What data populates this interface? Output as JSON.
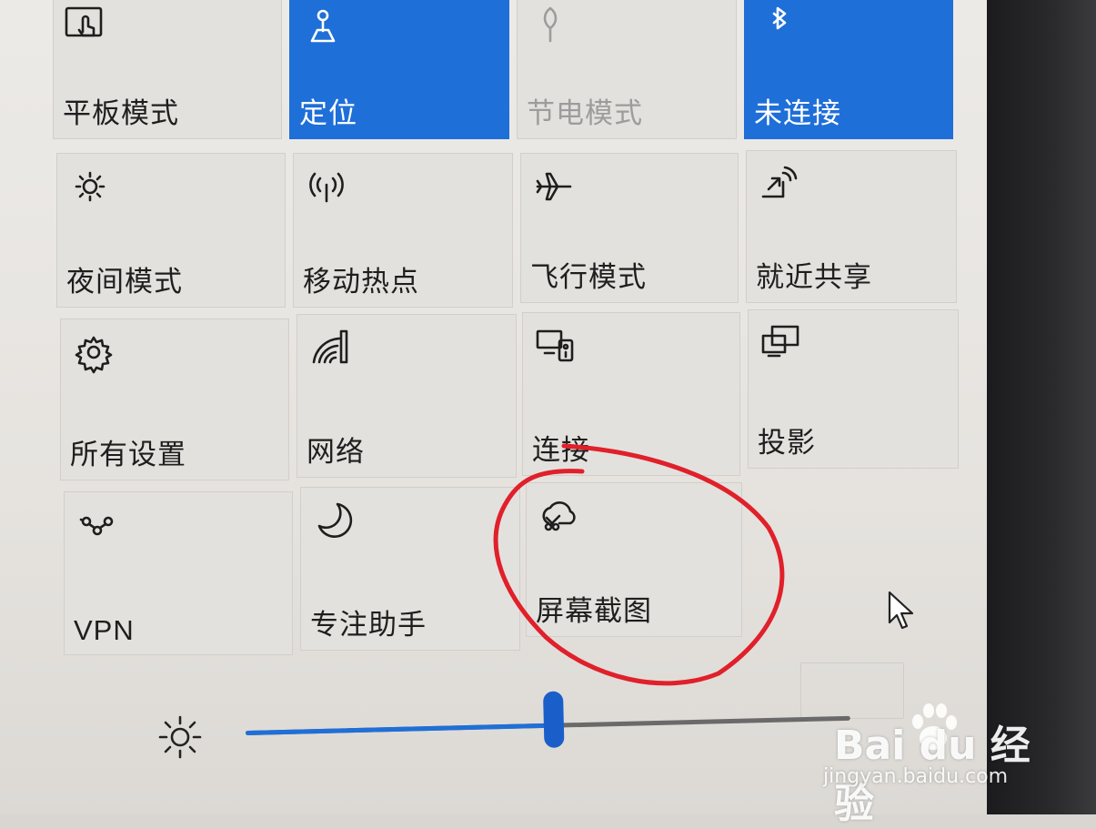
{
  "quick_actions": [
    {
      "label": "平板模式",
      "icon": "tablet-mode-icon",
      "state": "off"
    },
    {
      "label": "定位",
      "icon": "location-icon",
      "state": "on"
    },
    {
      "label": "节电模式",
      "icon": "battery-saver-icon",
      "state": "disabled"
    },
    {
      "label": "未连接",
      "icon": "bluetooth-icon",
      "state": "on"
    },
    {
      "label": "夜间模式",
      "icon": "night-light-icon",
      "state": "off"
    },
    {
      "label": "移动热点",
      "icon": "mobile-hotspot-icon",
      "state": "off"
    },
    {
      "label": "飞行模式",
      "icon": "airplane-icon",
      "state": "off"
    },
    {
      "label": "就近共享",
      "icon": "nearby-share-icon",
      "state": "off"
    },
    {
      "label": "所有设置",
      "icon": "gear-icon",
      "state": "off"
    },
    {
      "label": "网络",
      "icon": "network-icon",
      "state": "off"
    },
    {
      "label": "连接",
      "icon": "connect-icon",
      "state": "off"
    },
    {
      "label": "投影",
      "icon": "project-icon",
      "state": "off"
    },
    {
      "label": "VPN",
      "icon": "vpn-icon",
      "state": "off"
    },
    {
      "label": "专注助手",
      "icon": "moon-icon",
      "state": "off"
    },
    {
      "label": "屏幕截图",
      "icon": "screen-snip-icon",
      "state": "off",
      "highlighted": true
    }
  ],
  "brightness": {
    "icon": "brightness-icon",
    "level_percent": 51
  },
  "colors": {
    "accent": "#1f6fd8",
    "highlight": "#e0202a"
  },
  "watermark": {
    "logo_text": "Bai  du 经验",
    "url": "jingyan.baidu.com"
  }
}
